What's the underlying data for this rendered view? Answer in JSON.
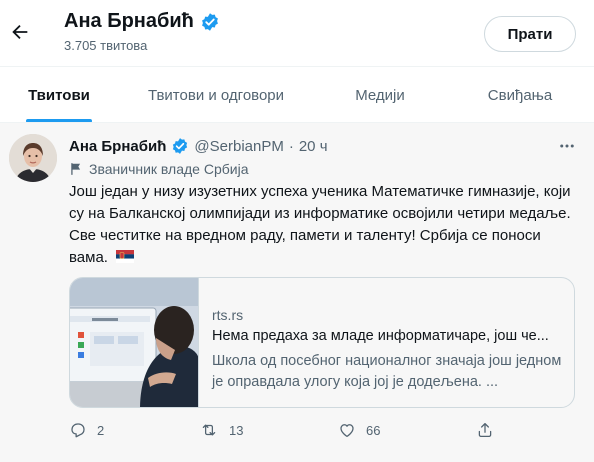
{
  "header": {
    "name": "Ана Брнабић",
    "tweet_count": "3.705 твитова",
    "follow_label": "Прати"
  },
  "tabs": [
    {
      "label": "Твитови",
      "active": true
    },
    {
      "label": "Твитови и одговори",
      "active": false
    },
    {
      "label": "Медији",
      "active": false
    },
    {
      "label": "Свиђања",
      "active": false
    }
  ],
  "tweet": {
    "author": "Ана Брнабић",
    "handle": "@SerbianPM",
    "separator": "·",
    "time": "20 ч",
    "label": "Званичник владе Србија",
    "text": "Још један у низу изузетних успеха ученика Математичке гимназије, који су на Балканској олимпијади из информатике освојили четири медаље. Све честитке на вредном раду, памети и таленту! Србија се поноси вама.",
    "flag_icon": "serbia-flag-icon",
    "card": {
      "domain": "rts.rs",
      "title": "Нема предаха за младе информатичаре, још че...",
      "description": "Школа од посебног националног значаја још једном је оправдала улогу која јој је додељена. ..."
    },
    "actions": {
      "replies": "2",
      "retweets": "13",
      "likes": "66"
    }
  },
  "colors": {
    "accent": "#1d9bf0",
    "text_primary": "#0f1419",
    "text_secondary": "#536471",
    "border": "#cfd9de"
  }
}
